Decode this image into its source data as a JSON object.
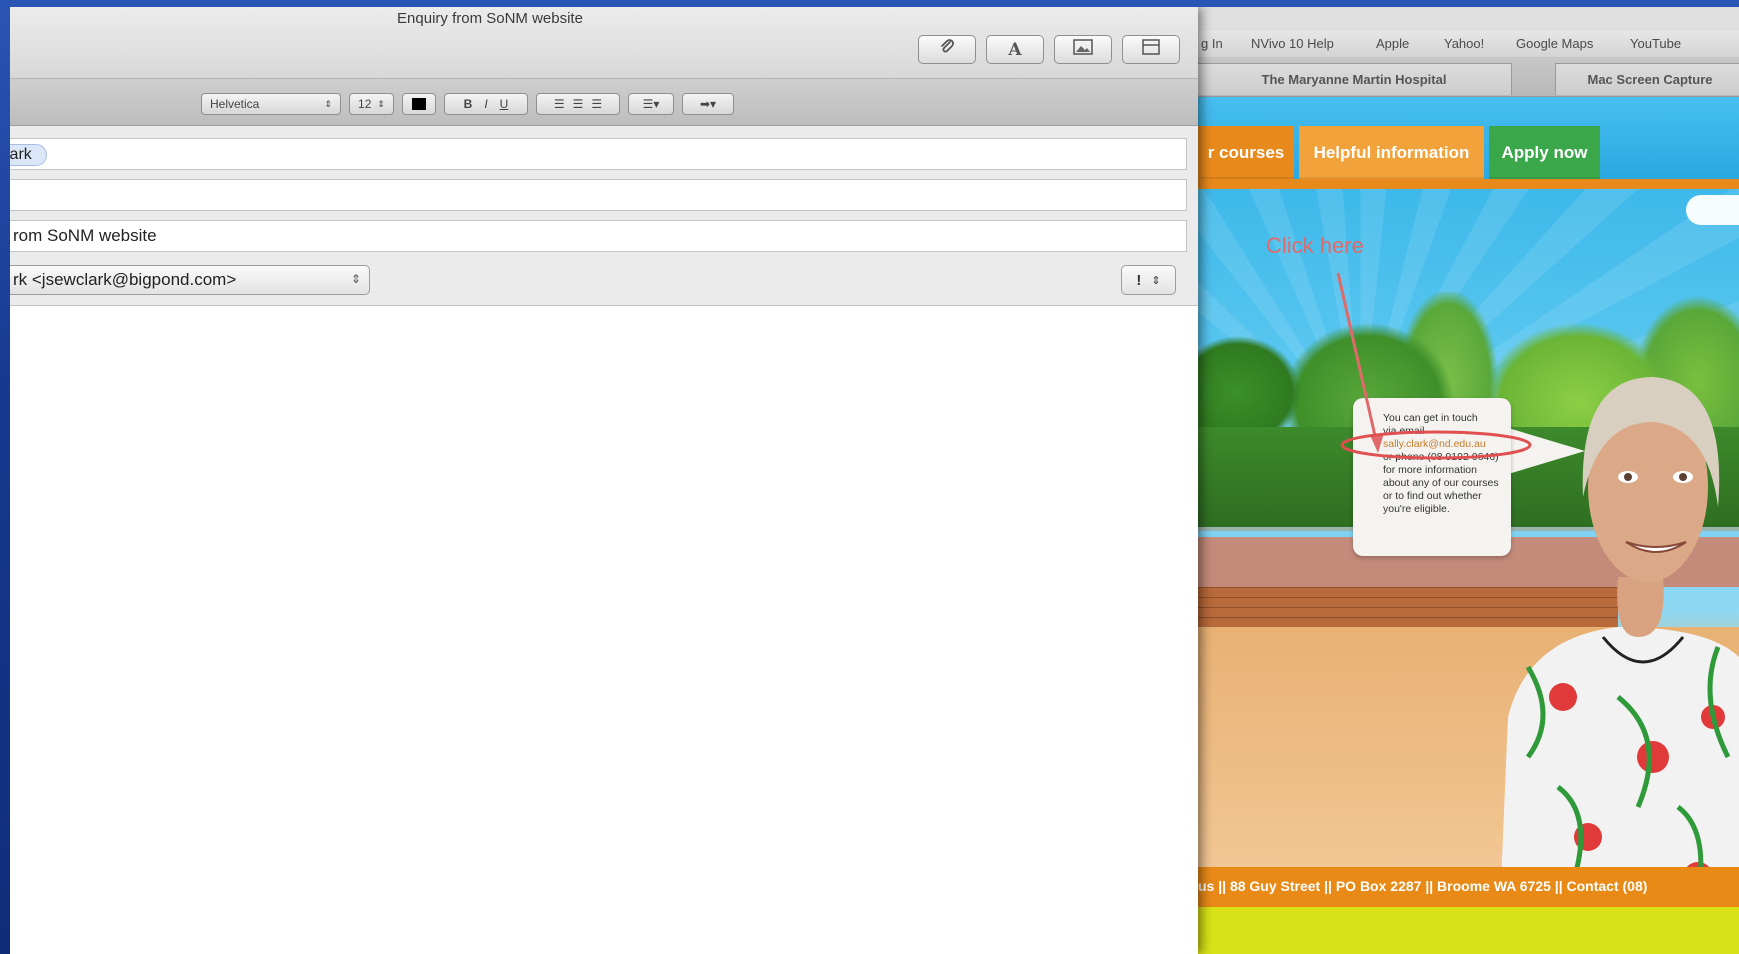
{
  "mail": {
    "title": "Enquiry from SoNM website",
    "toolbar": {
      "attach_icon": "paperclip-icon",
      "fonts_icon": "font-letter-icon",
      "photo_icon": "photo-browser-icon",
      "template_icon": "show-stationery-icon"
    },
    "format": {
      "font": "Helvetica",
      "size": "12",
      "bold": "B",
      "italic": "I",
      "underline": "U"
    },
    "to_value": "lark",
    "cc_value": "",
    "subject_value": "rom SoNM website",
    "from_value": "rk <jsewclark@bigpond.com>",
    "priority": "!"
  },
  "browser": {
    "bookmarks": [
      "g In",
      "NVivo 10 Help",
      "Apple",
      "Yahoo!",
      "Google Maps",
      "YouTube"
    ],
    "tabs": [
      "The Maryanne Martin Hospital",
      "Mac Screen Capture"
    ]
  },
  "site": {
    "nav": {
      "courses": "r courses",
      "helpful": "Helpful information",
      "apply": "Apply now"
    },
    "annotation": "Click here",
    "bubble": {
      "line1": "You can get in touch",
      "line2": "via email",
      "email": "sally.clark@nd.edu.au",
      "rest": "or phone (08 9192 0646) for more information about any of our courses or to find out whether you're eligible."
    },
    "footer": "us || 88 Guy Street || PO Box 2287 || Broome WA 6725 || Contact (08)"
  },
  "colors": {
    "nav_orange": "#e8891c",
    "nav_helpful": "#f2a23a",
    "nav_green": "#3aa84a",
    "annotation_red": "#e06a6a",
    "footer_yellow": "#d9e216"
  }
}
